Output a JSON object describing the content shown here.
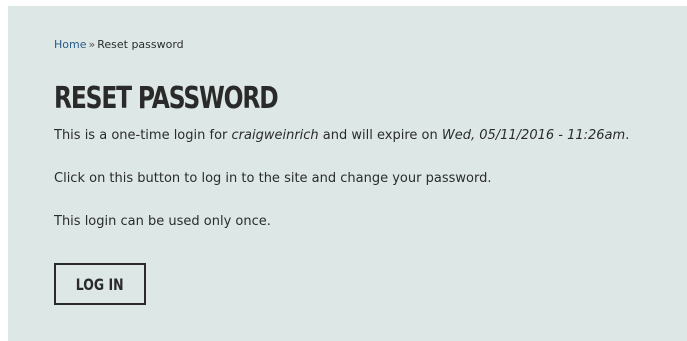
{
  "breadcrumb": {
    "home_label": "Home",
    "separator": "»",
    "current_label": "Reset password"
  },
  "page": {
    "title": "RESET PASSWORD"
  },
  "message": {
    "line1_prefix": "This is a one-time login for ",
    "username": "craigweinrich",
    "line1_middle": " and will expire on ",
    "expiry": "Wed, 05/11/2016 - 11:26am",
    "line1_suffix": ".",
    "line2": "Click on this button to log in to the site and change your password.",
    "line3": "This login can be used only once."
  },
  "form": {
    "login_button_label": "LOG IN"
  },
  "colors": {
    "panel_background": "#dde8e6",
    "link": "#2a5a8a",
    "text": "#2b2b2b"
  }
}
